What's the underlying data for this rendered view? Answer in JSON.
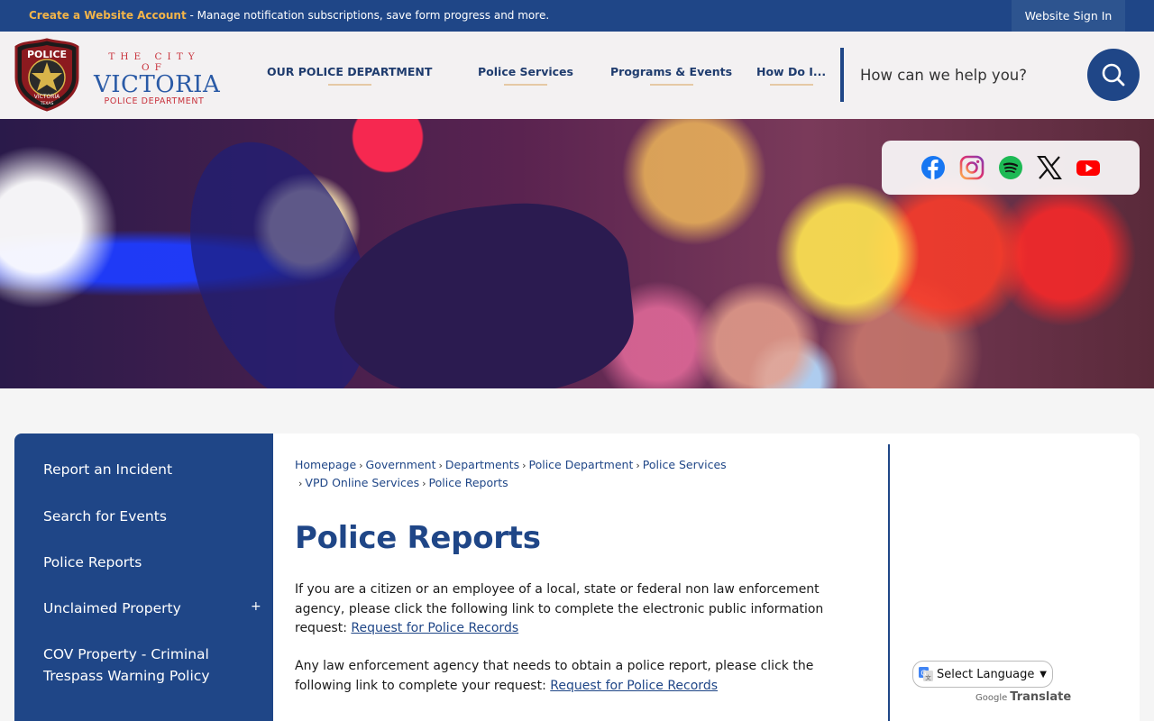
{
  "topbar": {
    "create_account": "Create a Website Account",
    "message": " - Manage notification subscriptions, save form progress and more.",
    "sign_in": "Website Sign In"
  },
  "logo": {
    "badge_text": "POLICE",
    "badge_city": "VICTORIA",
    "badge_state": "TEXAS",
    "city_line": "THE CITY OF",
    "city_name": "VICTORIA",
    "dept_line": "POLICE DEPARTMENT"
  },
  "nav": {
    "items": [
      {
        "label": "OUR POLICE DEPARTMENT"
      },
      {
        "label": "Police Services"
      },
      {
        "label": "Programs & Events"
      },
      {
        "label": "How Do I..."
      }
    ]
  },
  "search": {
    "placeholder": "How can we help you?"
  },
  "social": [
    "facebook-icon",
    "instagram-icon",
    "spotify-icon",
    "x-icon",
    "youtube-icon"
  ],
  "sidebar": {
    "items": [
      {
        "label": "Report an Incident"
      },
      {
        "label": "Search for Events"
      },
      {
        "label": "Police Reports"
      },
      {
        "label": "Unclaimed Property",
        "expand": "+"
      },
      {
        "label": "COV Property - Criminal Trespass Warning Policy"
      }
    ]
  },
  "breadcrumb": {
    "items": [
      "Homepage",
      "Government",
      "Departments",
      "Police Department",
      "Police Services",
      "VPD Online Services",
      "Police Reports"
    ]
  },
  "main": {
    "title": "Police Reports",
    "para1_text": "If you are a citizen or an employee of a local, state or federal non law enforcement agency, please click the following link to complete the electronic public information request: ",
    "para1_link": "Request for Police Records",
    "para2_text": "Any law enforcement agency that needs to obtain a police report, please click the following link to complete your request: ",
    "para2_link": "Request for Police Records"
  },
  "translate": {
    "select_label": "Select Language",
    "powered_by": "Google",
    "translate_word": "Translate"
  },
  "colors": {
    "primary": "#1f4687",
    "accent": "#f2b449",
    "logo_red": "#c8323c"
  }
}
